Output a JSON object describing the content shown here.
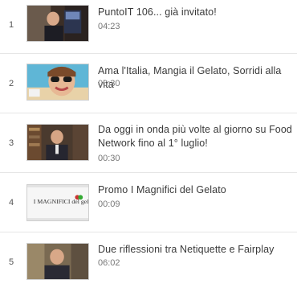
{
  "playlist": {
    "items": [
      {
        "index": "1",
        "title": "PuntoIT 106... già invitato!",
        "duration": "04:23",
        "thumb": "man-with-book-thumbnail"
      },
      {
        "index": "2",
        "title": "Ama l'Italia, Mangia il Gelato, Sorridi alla vita",
        "duration": "00:30",
        "thumb": "woman-with-sunglasses-thumbnail"
      },
      {
        "index": "3",
        "title": "Da oggi in onda più volte al giorno su Food Network fino al 1° luglio!",
        "duration": "00:30",
        "thumb": "man-in-library-thumbnail"
      },
      {
        "index": "4",
        "title": "Promo I Magnifici del Gelato",
        "duration": "00:09",
        "thumb": "magnifici-logo-thumbnail",
        "thumb_text": "I MAGNIFICI del gelato"
      },
      {
        "index": "5",
        "title": "Due riflessioni tra Netiquette e Fairplay",
        "duration": "06:02",
        "thumb": "man-speaking-thumbnail"
      }
    ]
  }
}
